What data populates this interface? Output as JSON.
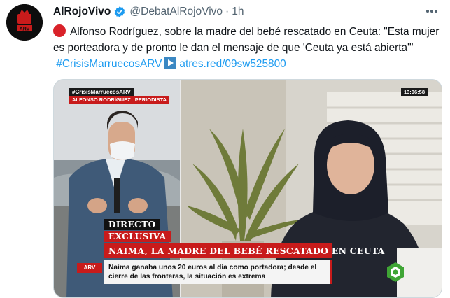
{
  "tweet": {
    "display_name": "AlRojoVivo",
    "handle": "@DebatAlRojoVivo",
    "separator": "·",
    "time": "1h",
    "text_intro": "Alfonso Rodríguez, sobre la madre del bebé rescatado en Ceuta: \"Esta mujer es porteadora y de pronto le dan el mensaje de que 'Ceuta ya está abierta'\"",
    "hashtag": "#CrisisMarruecosARV",
    "url": "atres.red/09sw525800",
    "icons": [
      "red-circle-emoji-icon",
      "play-button-emoji-icon",
      "verified-badge-icon",
      "more-options-icon"
    ]
  },
  "media": {
    "hashtag_tag": "#CrisisMarruecosARV",
    "reporter_name": "ALFONSO RODRÍGUEZ",
    "reporter_role": "PERIODISTA",
    "clock": "13:06:58",
    "label_live": "DIRECTO",
    "label_exclusive": "EXCLUSIVA",
    "headline": "NAIMA, LA MADRE DEL BEBÉ RESCATADO EN CEUTA",
    "subtitle": "Naima ganaba unos 20 euros al día como portadora; desde el cierre de las fronteras, la situación es extrema",
    "channel_logo": "ARV"
  },
  "colors": {
    "link": "#1d9bf0",
    "brand_red": "#c81b1b",
    "secondary_text": "#536471"
  }
}
